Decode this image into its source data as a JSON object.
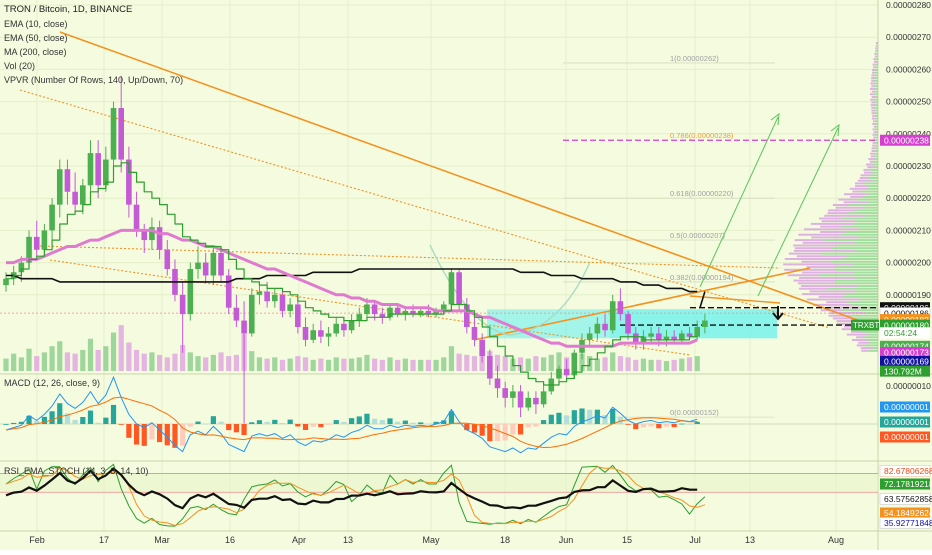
{
  "legend": {
    "title": "TRON / Bitcoin, 1D, BINANCE",
    "indicators": [
      "EMA (10, close)",
      "EMA (50, close)",
      "MA (200, close)",
      "Vol (20)",
      "VPVR (Number Of Rows, 140, Up/Down, 70)"
    ]
  },
  "colors": {
    "background": "#f4fbdf",
    "up": "#4caf50",
    "down": "#c45ad6",
    "ema10": "#2e9e2e",
    "ema50": "#e07ad0",
    "ma200": "#111111",
    "trend": "#f5921e",
    "fib": "#b0b0b0",
    "target": "#d53fd0",
    "cyan_box": "#5ff0ee",
    "arrow_green": "#5cc45c"
  },
  "fib_levels": [
    {
      "label": "1(0.00000262)",
      "value": 262
    },
    {
      "label": "0.786(0.00000238)",
      "value": 238
    },
    {
      "label": "0.618(0.00000220)",
      "value": 220
    },
    {
      "label": "0.5(0.00000207)",
      "value": 207
    },
    {
      "label": "0.382(0.00000194)",
      "value": 194
    },
    {
      "label": "0(0.00000152)",
      "value": 152
    }
  ],
  "axis": {
    "price_ticks": [
      "0.00000280",
      "0.00000270",
      "0.00000260",
      "0.00000250",
      "0.00000240",
      "0.00000230",
      "0.00000220",
      "0.00000210",
      "0.00000200",
      "0.00000190"
    ],
    "price_tick_values": [
      280,
      270,
      260,
      250,
      240,
      230,
      220,
      210,
      200,
      190
    ],
    "time_labels": [
      "Feb",
      "17",
      "Mar",
      "16",
      "Apr",
      "13",
      "May",
      "18",
      "Jun",
      "15",
      "Jul",
      "13",
      "Aug"
    ]
  },
  "price_badges": [
    {
      "label": "0.00000238",
      "value": 238,
      "color": "#d53fd0"
    },
    {
      "label": "0.00000186",
      "value": 186,
      "color": "#111111"
    },
    {
      "label": "0.00000186",
      "value": 184.3,
      "color": "#ffffff",
      "text": "#111111",
      "border": "#c9c9c9"
    },
    {
      "label": "0.00000182",
      "value": 182.3,
      "color": "#f5921e"
    },
    {
      "label": "0.00000180",
      "value": 180.6,
      "color": "#2e9e2e",
      "prefix": "TRXBTC"
    },
    {
      "label": "02:54:24",
      "value": 178.2,
      "color": "#ffffff",
      "text": "#2e9e2e"
    },
    {
      "label": "0.00000174",
      "value": 174,
      "color": "#4caf50"
    },
    {
      "label": "0.00000173",
      "value": 172.1,
      "color": "#d53fd0"
    },
    {
      "label": "0.00000169",
      "value": 169.3,
      "color": "#1010a0"
    },
    {
      "label": "130.792M",
      "value": 166.3,
      "color": "#2e9e2e"
    }
  ],
  "macd": {
    "label": "MACD (12, 26, close, 9)",
    "ticks": [
      "0.00000010"
    ],
    "badges": [
      {
        "label": "0.00000001",
        "color": "#2196f3"
      },
      {
        "label": "0.00000001",
        "color": "#26a69a"
      },
      {
        "label": "0.00000001",
        "color": "#ff5722"
      }
    ]
  },
  "rsi": {
    "label": "RSI_EMA_STOCH (14, 3, 3, 14, 10)",
    "badges": [
      {
        "label": "82.67806268",
        "value": 82.68,
        "color": "#ffffff",
        "text": "#e64a19",
        "border": "#f3c1a8"
      },
      {
        "label": "72.17819218",
        "value": 72.18,
        "color": "#2e9e2e"
      },
      {
        "label": "63.57562858",
        "value": 63.58,
        "color": "#ffffff",
        "text": "#111111",
        "border": "#c9c9c9"
      },
      {
        "label": "54.18492624",
        "value": 54.18,
        "color": "#f5921e"
      },
      {
        "label": "35.92771848",
        "value": 35.93,
        "color": "#ffffff",
        "text": "#1010a0",
        "border": "#c9c9c9"
      }
    ]
  },
  "chart_data": {
    "type": "candlestick",
    "title": "TRON / Bitcoin, 1D, BINANCE",
    "unit": "satoshi (1e-8 BTC)",
    "ylim": [
      150,
      280
    ],
    "candles": [
      {
        "o": 193,
        "h": 197,
        "l": 191,
        "c": 195
      },
      {
        "o": 195,
        "h": 199,
        "l": 193,
        "c": 197
      },
      {
        "o": 197,
        "h": 202,
        "l": 194,
        "c": 200
      },
      {
        "o": 200,
        "h": 210,
        "l": 198,
        "c": 208
      },
      {
        "o": 208,
        "h": 213,
        "l": 202,
        "c": 204
      },
      {
        "o": 204,
        "h": 212,
        "l": 203,
        "c": 210
      },
      {
        "o": 210,
        "h": 220,
        "l": 207,
        "c": 218
      },
      {
        "o": 218,
        "h": 232,
        "l": 214,
        "c": 229
      },
      {
        "o": 229,
        "h": 232,
        "l": 218,
        "c": 222
      },
      {
        "o": 222,
        "h": 228,
        "l": 216,
        "c": 218
      },
      {
        "o": 218,
        "h": 226,
        "l": 215,
        "c": 224
      },
      {
        "o": 224,
        "h": 238,
        "l": 221,
        "c": 234
      },
      {
        "o": 234,
        "h": 238,
        "l": 220,
        "c": 224
      },
      {
        "o": 224,
        "h": 236,
        "l": 222,
        "c": 232
      },
      {
        "o": 232,
        "h": 250,
        "l": 229,
        "c": 248
      },
      {
        "o": 248,
        "h": 258,
        "l": 228,
        "c": 232
      },
      {
        "o": 232,
        "h": 236,
        "l": 214,
        "c": 218
      },
      {
        "o": 218,
        "h": 222,
        "l": 208,
        "c": 210
      },
      {
        "o": 210,
        "h": 212,
        "l": 203,
        "c": 207
      },
      {
        "o": 207,
        "h": 214,
        "l": 204,
        "c": 211
      },
      {
        "o": 211,
        "h": 213,
        "l": 201,
        "c": 204
      },
      {
        "o": 204,
        "h": 207,
        "l": 196,
        "c": 198
      },
      {
        "o": 198,
        "h": 201,
        "l": 188,
        "c": 190
      },
      {
        "o": 190,
        "h": 194,
        "l": 172,
        "c": 184
      },
      {
        "o": 184,
        "h": 200,
        "l": 182,
        "c": 198
      },
      {
        "o": 198,
        "h": 205,
        "l": 195,
        "c": 200
      },
      {
        "o": 200,
        "h": 203,
        "l": 194,
        "c": 196
      },
      {
        "o": 196,
        "h": 205,
        "l": 193,
        "c": 203
      },
      {
        "o": 203,
        "h": 205,
        "l": 194,
        "c": 196
      },
      {
        "o": 196,
        "h": 198,
        "l": 184,
        "c": 186
      },
      {
        "o": 186,
        "h": 190,
        "l": 180,
        "c": 182
      },
      {
        "o": 182,
        "h": 188,
        "l": 150,
        "c": 178
      },
      {
        "o": 178,
        "h": 192,
        "l": 177,
        "c": 190
      },
      {
        "o": 190,
        "h": 194,
        "l": 187,
        "c": 191
      },
      {
        "o": 191,
        "h": 194,
        "l": 186,
        "c": 188
      },
      {
        "o": 188,
        "h": 192,
        "l": 186,
        "c": 190
      },
      {
        "o": 190,
        "h": 191,
        "l": 183,
        "c": 185
      },
      {
        "o": 185,
        "h": 189,
        "l": 183,
        "c": 187
      },
      {
        "o": 187,
        "h": 188,
        "l": 178,
        "c": 180
      },
      {
        "o": 180,
        "h": 183,
        "l": 174,
        "c": 176
      },
      {
        "o": 176,
        "h": 181,
        "l": 175,
        "c": 179
      },
      {
        "o": 179,
        "h": 182,
        "l": 175,
        "c": 177
      },
      {
        "o": 177,
        "h": 180,
        "l": 174,
        "c": 178
      },
      {
        "o": 178,
        "h": 183,
        "l": 177,
        "c": 181
      },
      {
        "o": 181,
        "h": 183,
        "l": 177,
        "c": 179
      },
      {
        "o": 179,
        "h": 184,
        "l": 178,
        "c": 182
      },
      {
        "o": 182,
        "h": 186,
        "l": 180,
        "c": 184
      },
      {
        "o": 184,
        "h": 189,
        "l": 182,
        "c": 187
      },
      {
        "o": 187,
        "h": 188,
        "l": 182,
        "c": 184
      },
      {
        "o": 184,
        "h": 186,
        "l": 181,
        "c": 183
      },
      {
        "o": 183,
        "h": 187,
        "l": 182,
        "c": 186
      },
      {
        "o": 186,
        "h": 187,
        "l": 183,
        "c": 184
      },
      {
        "o": 184,
        "h": 186,
        "l": 182,
        "c": 185
      },
      {
        "o": 185,
        "h": 187,
        "l": 183,
        "c": 184
      },
      {
        "o": 184,
        "h": 186,
        "l": 183,
        "c": 185
      },
      {
        "o": 185,
        "h": 187,
        "l": 183,
        "c": 184
      },
      {
        "o": 184,
        "h": 186,
        "l": 183,
        "c": 185
      },
      {
        "o": 185,
        "h": 188,
        "l": 184,
        "c": 187
      },
      {
        "o": 187,
        "h": 198,
        "l": 186,
        "c": 197
      },
      {
        "o": 197,
        "h": 198,
        "l": 185,
        "c": 187
      },
      {
        "o": 187,
        "h": 189,
        "l": 178,
        "c": 180
      },
      {
        "o": 180,
        "h": 183,
        "l": 174,
        "c": 176
      },
      {
        "o": 176,
        "h": 178,
        "l": 169,
        "c": 171
      },
      {
        "o": 171,
        "h": 173,
        "l": 162,
        "c": 164
      },
      {
        "o": 164,
        "h": 168,
        "l": 158,
        "c": 161
      },
      {
        "o": 161,
        "h": 163,
        "l": 155,
        "c": 158
      },
      {
        "o": 158,
        "h": 162,
        "l": 155,
        "c": 160
      },
      {
        "o": 160,
        "h": 162,
        "l": 152,
        "c": 155
      },
      {
        "o": 155,
        "h": 160,
        "l": 154,
        "c": 158
      },
      {
        "o": 158,
        "h": 160,
        "l": 153,
        "c": 156
      },
      {
        "o": 156,
        "h": 162,
        "l": 155,
        "c": 160
      },
      {
        "o": 160,
        "h": 166,
        "l": 159,
        "c": 164
      },
      {
        "o": 164,
        "h": 168,
        "l": 162,
        "c": 167
      },
      {
        "o": 167,
        "h": 170,
        "l": 163,
        "c": 165
      },
      {
        "o": 165,
        "h": 173,
        "l": 164,
        "c": 172
      },
      {
        "o": 172,
        "h": 178,
        "l": 170,
        "c": 176
      },
      {
        "o": 176,
        "h": 180,
        "l": 174,
        "c": 178
      },
      {
        "o": 178,
        "h": 183,
        "l": 176,
        "c": 181
      },
      {
        "o": 181,
        "h": 184,
        "l": 177,
        "c": 179
      },
      {
        "o": 179,
        "h": 190,
        "l": 178,
        "c": 188
      },
      {
        "o": 188,
        "h": 192,
        "l": 182,
        "c": 184
      },
      {
        "o": 184,
        "h": 185,
        "l": 176,
        "c": 178
      },
      {
        "o": 178,
        "h": 180,
        "l": 173,
        "c": 175
      },
      {
        "o": 175,
        "h": 179,
        "l": 173,
        "c": 177
      },
      {
        "o": 177,
        "h": 180,
        "l": 175,
        "c": 178
      },
      {
        "o": 178,
        "h": 180,
        "l": 174,
        "c": 176
      },
      {
        "o": 176,
        "h": 179,
        "l": 174,
        "c": 177
      },
      {
        "o": 177,
        "h": 179,
        "l": 175,
        "c": 176
      },
      {
        "o": 176,
        "h": 179,
        "l": 175,
        "c": 178
      },
      {
        "o": 178,
        "h": 180,
        "l": 176,
        "c": 177
      },
      {
        "o": 177,
        "h": 182,
        "l": 176,
        "c": 180
      },
      {
        "o": 180,
        "h": 184,
        "l": 178,
        "c": 182
      }
    ],
    "ema10": [
      195,
      196,
      198,
      201,
      202,
      204,
      207,
      212,
      215,
      216,
      218,
      222,
      223,
      225,
      230,
      231,
      228,
      225,
      222,
      220,
      218,
      215,
      212,
      208,
      207,
      206,
      205,
      205,
      204,
      201,
      198,
      195,
      194,
      193,
      192,
      192,
      191,
      190,
      188,
      186,
      185,
      184,
      183,
      183,
      182,
      182,
      182,
      183,
      183,
      183,
      184,
      184,
      184,
      184,
      184,
      184,
      184,
      185,
      187,
      187,
      185,
      183,
      180,
      177,
      174,
      171,
      168,
      166,
      164,
      163,
      162,
      162,
      163,
      164,
      166,
      168,
      170,
      172,
      174,
      176,
      177,
      177,
      177,
      176,
      176,
      176,
      176,
      176,
      176,
      177,
      177
    ],
    "ema50": [
      200,
      200,
      201,
      201,
      201,
      202,
      203,
      204,
      205,
      205,
      206,
      207,
      207,
      208,
      209,
      210,
      210,
      210,
      210,
      210,
      209,
      209,
      208,
      207,
      207,
      206,
      205,
      205,
      204,
      203,
      202,
      201,
      200,
      199,
      198,
      198,
      197,
      196,
      195,
      194,
      193,
      192,
      191,
      190,
      190,
      189,
      189,
      188,
      188,
      187,
      187,
      187,
      186,
      186,
      186,
      186,
      185,
      185,
      185,
      185,
      185,
      184,
      183,
      183,
      182,
      181,
      180,
      179,
      178,
      177,
      176,
      175,
      175,
      174,
      174,
      174,
      174,
      174,
      174,
      174,
      175,
      175,
      175,
      175,
      175,
      175,
      175,
      175,
      175,
      175,
      176
    ],
    "ma200": [
      196,
      196,
      195,
      195,
      195,
      195,
      195,
      194,
      194,
      194,
      194,
      194,
      194,
      194,
      194,
      194,
      194,
      194,
      194,
      194,
      194,
      194,
      194,
      194,
      194,
      194,
      194,
      194,
      194,
      194,
      195,
      195,
      195,
      195,
      196,
      196,
      196,
      196,
      196,
      196,
      197,
      197,
      197,
      197,
      197,
      197,
      198,
      198,
      198,
      198,
      198,
      198,
      198,
      198,
      198,
      198,
      198,
      198,
      198,
      198,
      198,
      198,
      198,
      198,
      198,
      198,
      198,
      197,
      197,
      197,
      197,
      196,
      196,
      196,
      196,
      195,
      195,
      195,
      195,
      195,
      194,
      194,
      194,
      193,
      193,
      193,
      192,
      192,
      192,
      191,
      191
    ],
    "volume": [
      20,
      28,
      22,
      36,
      24,
      30,
      40,
      48,
      30,
      28,
      34,
      52,
      34,
      40,
      62,
      74,
      46,
      34,
      28,
      30,
      26,
      22,
      28,
      42,
      30,
      24,
      22,
      26,
      30,
      24,
      26,
      60,
      32,
      22,
      20,
      22,
      18,
      20,
      24,
      22,
      18,
      20,
      18,
      22,
      20,
      20,
      22,
      26,
      20,
      18,
      22,
      18,
      20,
      18,
      18,
      18,
      18,
      22,
      40,
      28,
      26,
      24,
      28,
      32,
      26,
      24,
      20,
      22,
      20,
      24,
      22,
      26,
      30,
      22,
      26,
      28,
      24,
      20,
      22,
      30,
      24,
      22,
      18,
      20,
      18,
      18,
      16,
      18,
      20,
      22,
      24
    ]
  }
}
